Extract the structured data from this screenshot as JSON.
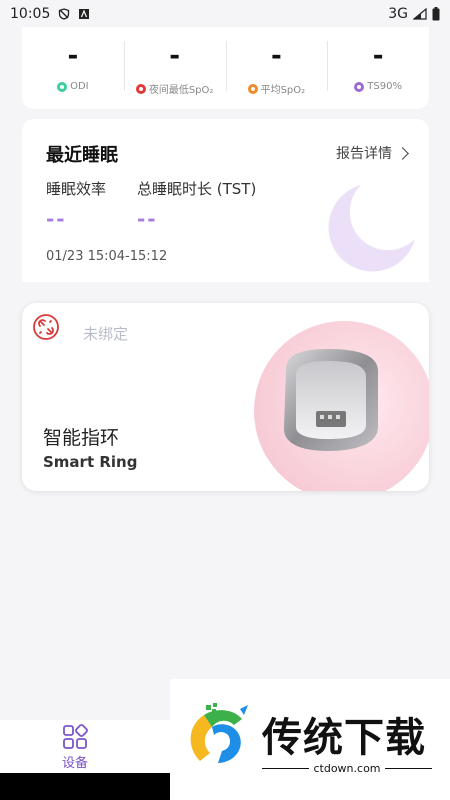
{
  "status_bar": {
    "time": "10:05",
    "network": "3G"
  },
  "metrics": [
    {
      "value": "-",
      "label": "ODI",
      "color": "#3ccf9a"
    },
    {
      "value": "-",
      "label": "夜间最低SpO₂",
      "color": "#e23a3a"
    },
    {
      "value": "-",
      "label": "平均SpO₂",
      "color": "#f08a2a"
    },
    {
      "value": "-",
      "label": "TS90%",
      "color": "#9a6ad6"
    }
  ],
  "sleep": {
    "title": "最近睡眠",
    "report_link": "报告详情",
    "efficiency_label": "睡眠效率",
    "efficiency_value": "--",
    "tst_label": "总睡眠时长 (TST)",
    "tst_value": "--",
    "time_range": "01/23 15:04-15:12"
  },
  "device": {
    "status": "未绑定",
    "name_cn": "智能指环",
    "name_en": "Smart Ring"
  },
  "bottom_nav": {
    "device_label": "设备"
  },
  "watermark": {
    "title": "传统下载",
    "url": "ctdown.com"
  },
  "colors": {
    "accent": "#a77ddd",
    "nav_active": "#7a55c8",
    "unbound": "#d93a3a"
  }
}
